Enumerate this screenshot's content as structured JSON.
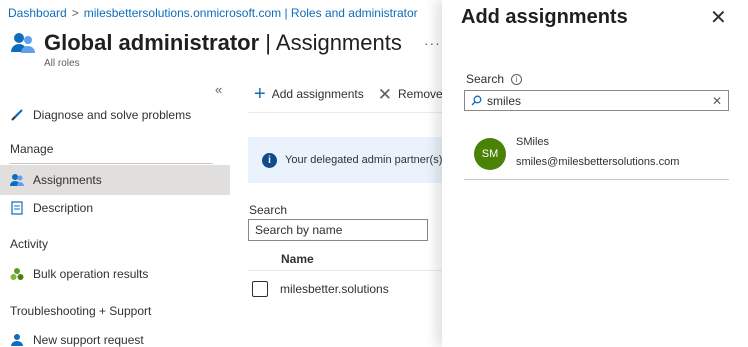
{
  "breadcrumb": {
    "items": [
      "Dashboard",
      "milesbettersolutions.onmicrosoft.com | Roles and administrator"
    ],
    "separator": ">"
  },
  "header": {
    "title_bold": "Global administrator",
    "title_sep": " | ",
    "title_light": "Assignments",
    "more": "···",
    "subtitle": "All roles"
  },
  "sidebar": {
    "collapse": "«",
    "diagnose": "Diagnose and solve problems",
    "sections": {
      "manage": "Manage",
      "activity": "Activity",
      "troubleshooting": "Troubleshooting + Support"
    },
    "items": {
      "assignments": "Assignments",
      "description": "Description",
      "bulk": "Bulk operation results",
      "support": "New support request"
    }
  },
  "toolbar": {
    "add_label": "Add assignments",
    "remove_label": "Remove"
  },
  "banner": {
    "text": "Your delegated admin partner(s) c"
  },
  "main_search": {
    "label": "Search",
    "placeholder": "Search by name"
  },
  "table": {
    "column_name": "Name",
    "rows": [
      {
        "name": "milesbetter.solutions"
      }
    ]
  },
  "panel": {
    "title": "Add assignments",
    "close": "✕",
    "search_label": "Search",
    "search_value": "smiles",
    "clear": "✕",
    "result": {
      "initials": "SM",
      "name": "SMiles",
      "email": "smiles@milesbettersolutions.com"
    }
  },
  "colors": {
    "accent": "#0f6cbd",
    "selected_nav": "#e1dfdd",
    "avatar": "#498205",
    "banner": "#eaf3fc"
  }
}
